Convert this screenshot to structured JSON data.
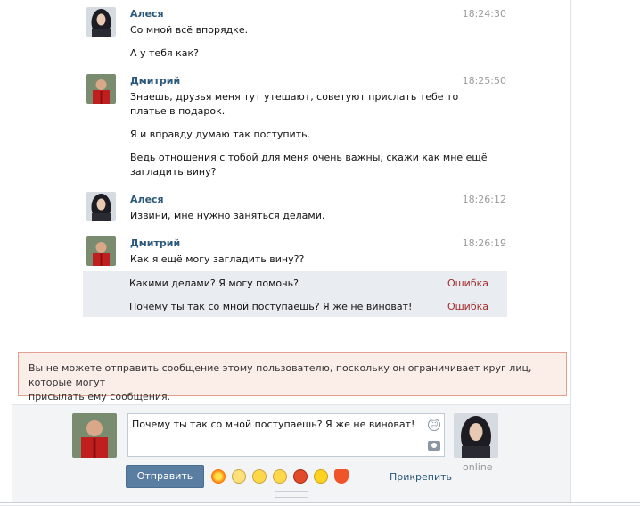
{
  "messages": [
    {
      "sender": "Алеся",
      "time": "18:24:30",
      "avatar": "female-avatar",
      "lines": [
        "Со мной всё впорядке.",
        "А у тебя как?"
      ]
    },
    {
      "sender": "Дмитрий",
      "time": "18:25:50",
      "avatar": "male-avatar",
      "lines": [
        "Знаешь, друзья меня тут утешают, советуют прислать тебе то",
        "платье в подарок.",
        "Я и вправду думаю так поступить.",
        "Ведь отношения с тобой для меня очень важны, скажи как мне ещё",
        "загладить вину?"
      ]
    },
    {
      "sender": "Алеся",
      "time": "18:26:12",
      "avatar": "female-avatar",
      "lines": [
        "Извини, мне нужно заняться делами."
      ]
    },
    {
      "sender": "Дмитрий",
      "time": "18:26:19",
      "avatar": "male-avatar",
      "lines": [
        "Как я ещё могу загладить вину??"
      ]
    }
  ],
  "failed_messages": [
    {
      "text": "Какими делами? Я могу помочь?",
      "status": "Ошибка"
    },
    {
      "text": "Почему ты так со мной поступаешь? Я же не виноват!",
      "status": "Ошибка"
    }
  ],
  "warning_text_1": "Вы не можете отправить сообщение этому пользователю, поскольку он ограничивает круг лиц, которые могут",
  "warning_text_2": "присылать ему сообщения.",
  "compose": {
    "input_value": "Почему ты так со мной поступаешь? Я же не виноват!",
    "send_label": "Отправить",
    "attach_label": "Прикрепить",
    "recipient_status": "online"
  },
  "emojis": [
    "explosion",
    "eyes-roll",
    "grin",
    "tired",
    "angry",
    "chick",
    "heart"
  ],
  "colors": {
    "link": "#2b587a",
    "error": "#a32b2b",
    "button": "#5a7ea2",
    "warning_bg": "#fbeee9",
    "warning_border": "#e3a08f"
  }
}
